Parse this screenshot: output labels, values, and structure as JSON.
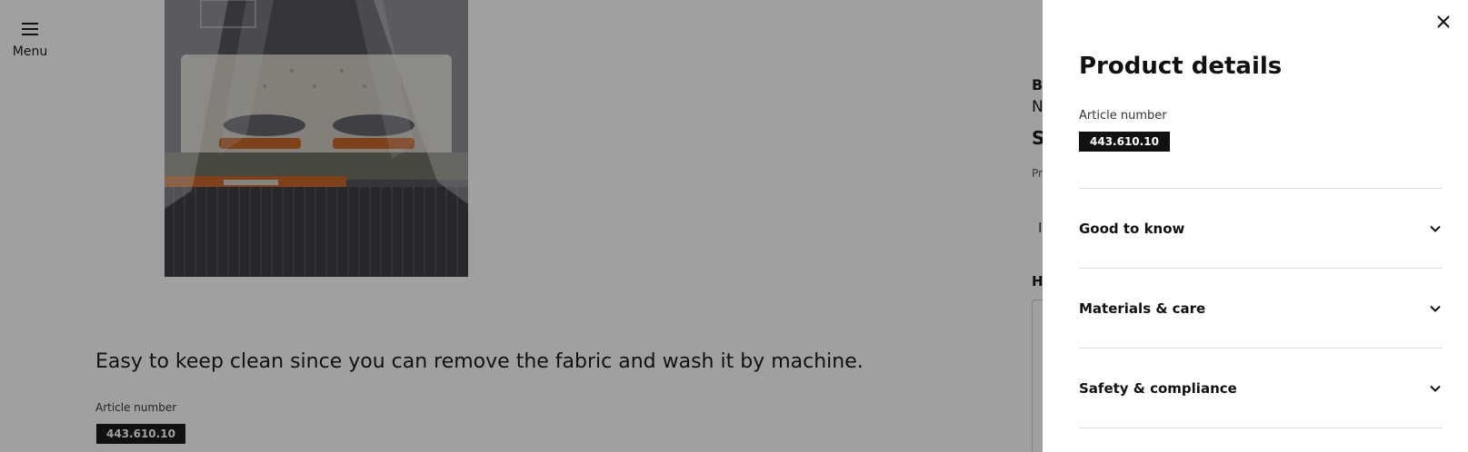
{
  "header": {
    "menu_label": "Menu"
  },
  "background": {
    "description": "Easy to keep clean since you can remove the fabric and wash it by machine.",
    "article_label": "Article number",
    "article_number": "443.610.10",
    "peek": {
      "b": "B",
      "n": "N",
      "s": "S",
      "pr": "Pr",
      "i": "I",
      "h": "H"
    }
  },
  "drawer": {
    "title": "Product details",
    "article_label": "Article number",
    "article_number": "443.610.10",
    "sections": [
      {
        "label": "Good to know"
      },
      {
        "label": "Materials & care"
      },
      {
        "label": "Safety & compliance"
      }
    ]
  },
  "icons": {
    "menu": "hamburger-menu-icon",
    "close": "close-icon",
    "chevron": "chevron-down-icon"
  },
  "colors": {
    "overlay": "#111111",
    "badge_bg": "#111111",
    "badge_text": "#ffffff",
    "text": "#111111"
  }
}
